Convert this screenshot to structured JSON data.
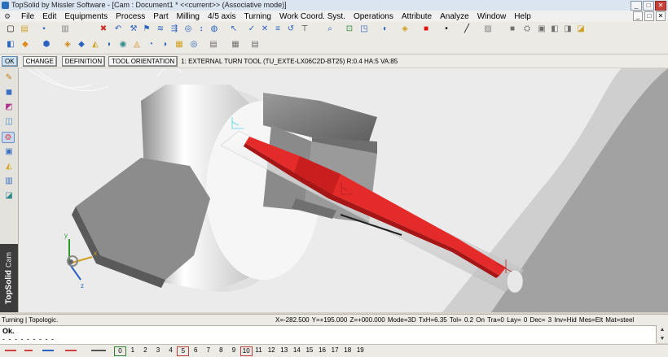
{
  "window": {
    "title": "TopSolid by Missler Software - [Cam : Document1 *  <<current>> (Associative mode)]",
    "controls": [
      "_",
      "□",
      "✕"
    ]
  },
  "menubar": {
    "items": [
      "File",
      "Edit",
      "Equipments",
      "Process",
      "Part",
      "Milling",
      "4/5 axis",
      "Turning",
      "Work Coord. Syst.",
      "Operations",
      "Attribute",
      "Analyze",
      "Window",
      "Help"
    ],
    "mdi_controls": [
      "_",
      "□",
      "✕"
    ]
  },
  "toolbar_top": {
    "icons": [
      {
        "name": "new-icon",
        "glyph": "▢",
        "color": "#ffffff"
      },
      {
        "name": "open-icon",
        "glyph": "▤",
        "color": "#e8c35a"
      },
      {
        "name": "save-icon",
        "glyph": "▪",
        "color": "#3a6fc2"
      },
      {
        "name": "print-icon",
        "glyph": "▥",
        "color": "#b0b0b0"
      },
      {
        "name": "delete-icon",
        "glyph": "✖",
        "color": "#d02a2a"
      },
      {
        "name": "undo-icon",
        "glyph": "↶",
        "color": "#2a62c2"
      },
      {
        "name": "pointer-icon",
        "glyph": "↖",
        "color": "#2a62c2"
      },
      {
        "name": "attribute-icon",
        "glyph": "≡",
        "color": "#2a62c2"
      },
      {
        "name": "zoom-icon",
        "glyph": "⌕",
        "color": "#2a62c2"
      },
      {
        "name": "fit-icon",
        "glyph": "⊡",
        "color": "#2a8a3a"
      },
      {
        "name": "color-swatch-icon",
        "glyph": "■",
        "color": "#e01010"
      },
      {
        "name": "point-style-icon",
        "glyph": "•",
        "color": "#000000"
      },
      {
        "name": "line-style-icon",
        "glyph": "╱",
        "color": "#000000"
      },
      {
        "name": "hatch-icon",
        "glyph": "▨",
        "color": "#808080"
      }
    ]
  },
  "toolbar_second": {
    "icons": [
      {
        "name": "machine-icon",
        "glyph": "◧",
        "color": "#2a62c2"
      },
      {
        "name": "tool-icon",
        "glyph": "◆",
        "color": "#e08a20"
      },
      {
        "name": "stock-icon",
        "glyph": "⬢",
        "color": "#2a62c2"
      },
      {
        "name": "part-icon",
        "glyph": "◈",
        "color": "#d08a10"
      },
      {
        "name": "fixture-icon",
        "glyph": "◉",
        "color": "#2a8a8a"
      },
      {
        "name": "sequence-icon",
        "glyph": "▦",
        "color": "#d0a020"
      },
      {
        "name": "sheet-icon",
        "glyph": "▤",
        "color": "#707070"
      }
    ]
  },
  "command_bar": {
    "buttons": [
      "OK",
      "CHANGE",
      "DEFINITION",
      "TOOL ORIENTATION"
    ],
    "text": "1: EXTERNAL TURN TOOL (TU_EXTE-LX06C2D-BT25) R:0.4  HA:5  VA:85"
  },
  "left_tools": [
    {
      "name": "pencil-icon",
      "glyph": "✎",
      "color": "#c08020"
    },
    {
      "name": "cube-icon",
      "glyph": "◼",
      "color": "#3a6fc2"
    },
    {
      "name": "shape-icon",
      "glyph": "◩",
      "color": "#b03090"
    },
    {
      "name": "assembly-icon",
      "glyph": "◫",
      "color": "#3a8ac2"
    },
    {
      "name": "cam-icon",
      "glyph": "⚙",
      "color": "#d04040",
      "active": true
    },
    {
      "name": "draft-icon",
      "glyph": "▣",
      "color": "#3a6fc2"
    },
    {
      "name": "electrode-icon",
      "glyph": "◭",
      "color": "#e0a020"
    },
    {
      "name": "mold-icon",
      "glyph": "▥",
      "color": "#3a6fc2"
    },
    {
      "name": "sheetmetal-icon",
      "glyph": "◪",
      "color": "#2a8a8a"
    }
  ],
  "sidebar_label": {
    "brand": "TopSolid",
    "module": "Cam"
  },
  "status": {
    "mode_text": "Turning | Topologic.",
    "info": "X=-282.500  Y=+195.000  Z=+000.000  Mode=3D  TxH=6.35  Tol= 0.2  On  Tra=0  Lay= 0  Dec= 3  Inv=Hid  Mes=Elt  Mat=steel"
  },
  "output": {
    "line1": "Ok.",
    "line2": "- - - - - - - - -"
  },
  "scroll_arrows": [
    "▲",
    "▼"
  ],
  "layers": {
    "current": "0",
    "used": [
      "5",
      "10"
    ],
    "items": [
      "0",
      "1",
      "2",
      "3",
      "4",
      "5",
      "6",
      "7",
      "8",
      "9",
      "10",
      "11",
      "12",
      "13",
      "14",
      "15",
      "16",
      "17",
      "18",
      "19"
    ]
  }
}
